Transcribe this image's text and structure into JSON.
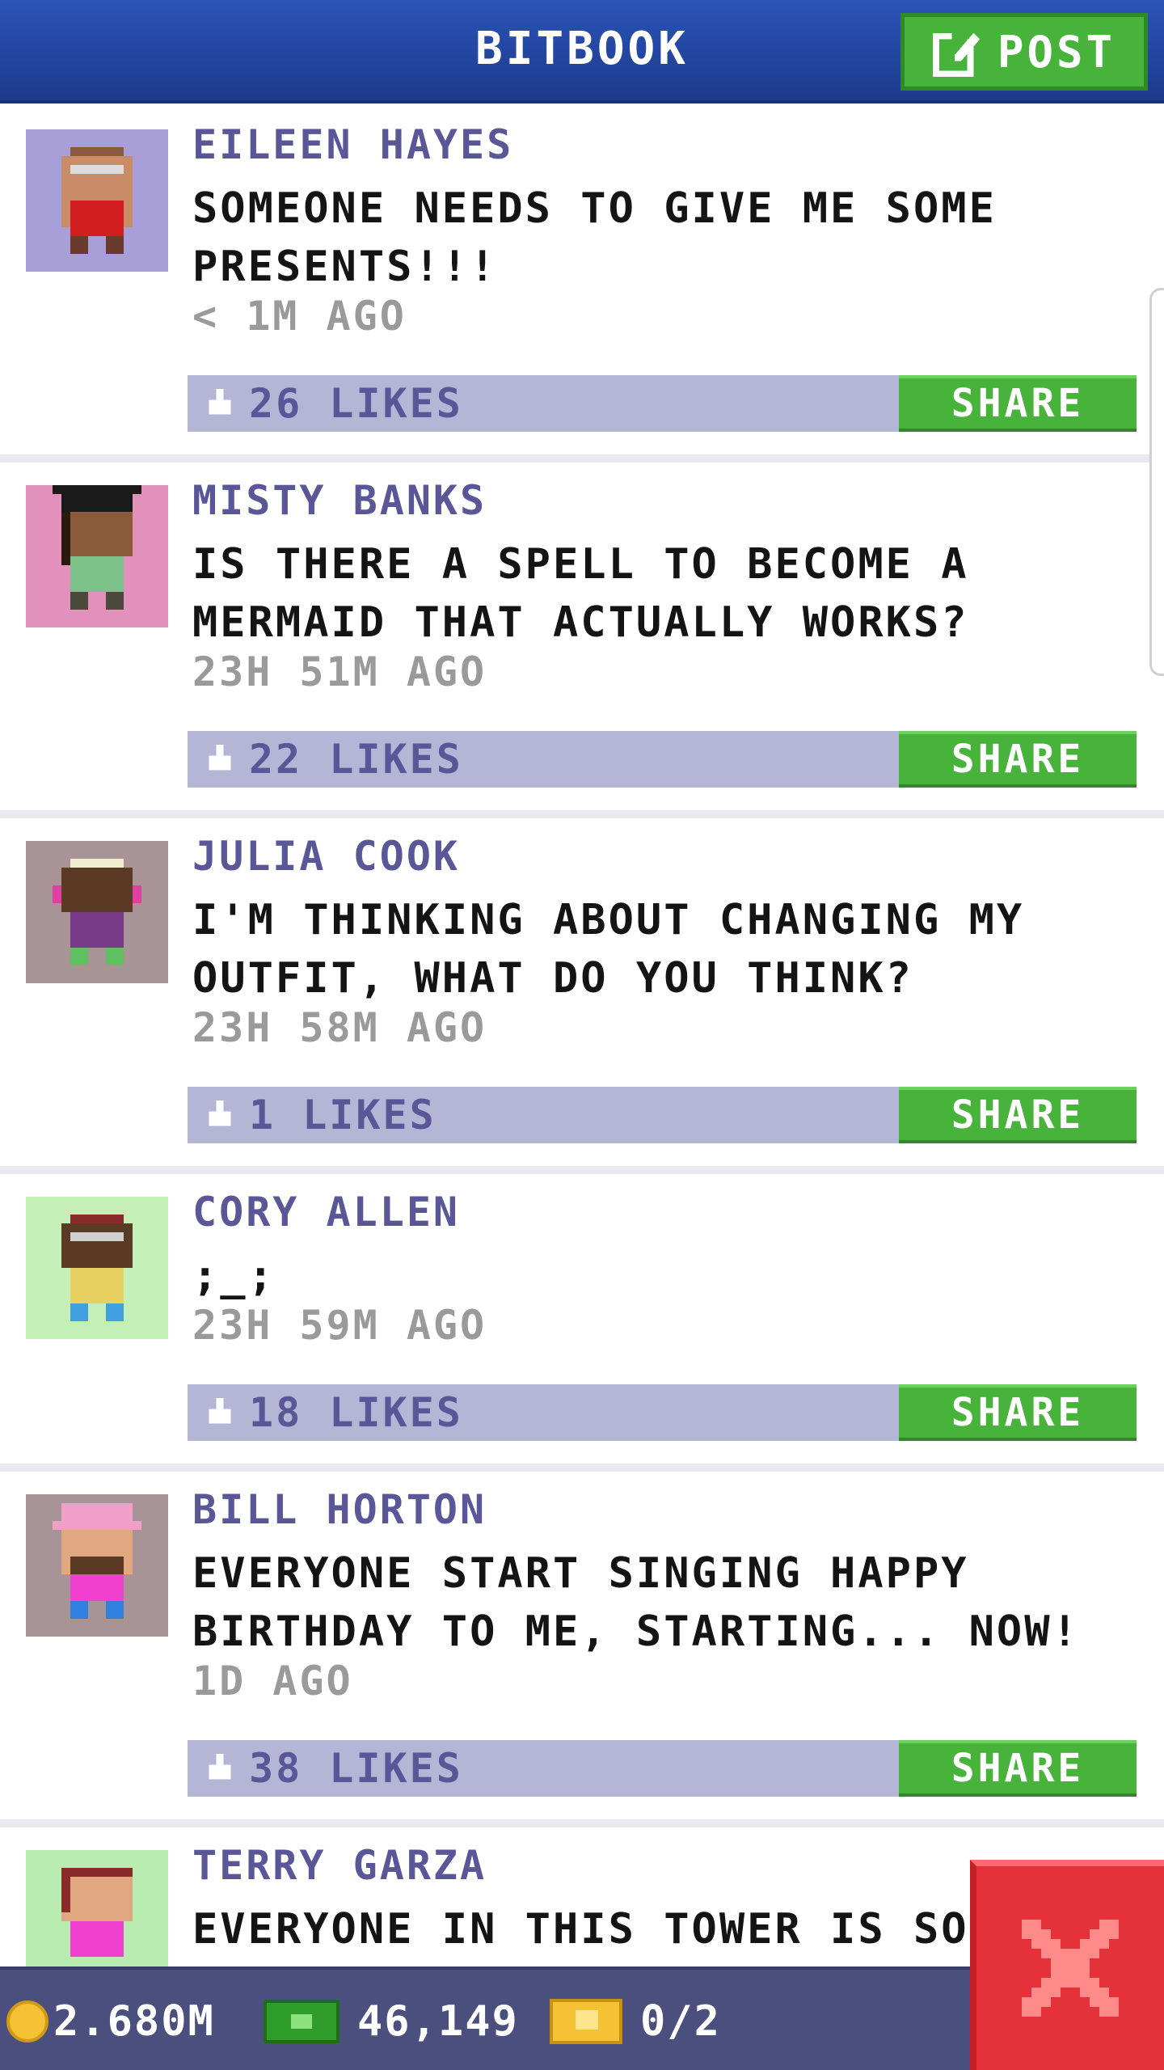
{
  "header": {
    "title": "BITBOOK",
    "post_label": "POST"
  },
  "posts": [
    {
      "author": "EILEEN HAYES",
      "message": "SOMEONE NEEDS TO GIVE ME SOME PRESENTS!!!",
      "time": "< 1M AGO",
      "likes": "26 LIKES",
      "share_label": "SHARE",
      "avatar_bg": "#a89ed8"
    },
    {
      "author": "MISTY BANKS",
      "message": "IS THERE A SPELL TO BECOME A MERMAID THAT ACTUALLY WORKS?",
      "time": "23H 51M AGO",
      "likes": "22 LIKES",
      "share_label": "SHARE",
      "avatar_bg": "#e291bc"
    },
    {
      "author": "JULIA COOK",
      "message": "I'M THINKING ABOUT CHANGING MY OUTFIT, WHAT DO YOU THINK?",
      "time": "23H 58M AGO",
      "likes": "1 LIKES",
      "share_label": "SHARE",
      "avatar_bg": "#a89496"
    },
    {
      "author": "CORY ALLEN",
      "message": ";_;",
      "time": "23H 59M AGO",
      "likes": "18 LIKES",
      "share_label": "SHARE",
      "avatar_bg": "#c4f0b8"
    },
    {
      "author": "BILL HORTON",
      "message": "EVERYONE START SINGING HAPPY BIRTHDAY TO ME, STARTING... NOW!",
      "time": "1D AGO",
      "likes": "38 LIKES",
      "share_label": "SHARE",
      "avatar_bg": "#a89496"
    },
    {
      "author": "TERRY GARZA",
      "message": "EVERYONE IN THIS TOWER IS SO",
      "avatar_bg": "#b8ecb0"
    }
  ],
  "status": {
    "coins": "2.680M",
    "bux": "46,149",
    "tickets": "0/2"
  },
  "icons": {
    "post": "edit-icon",
    "like": "thumbs-up-icon",
    "close": "close-icon",
    "coin": "coin-icon",
    "bux": "bux-icon",
    "ticket": "ticket-icon"
  },
  "colors": {
    "header": "#1c3a8c",
    "green_button": "#47b33a",
    "like_bar": "#b5b6d6",
    "author_text": "#5a5798",
    "close_red": "#e5323a",
    "status_bar": "#4b4f7e"
  }
}
